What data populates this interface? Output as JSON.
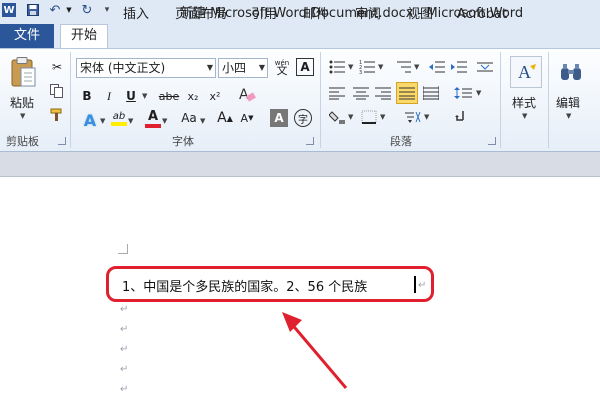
{
  "app": {
    "title": "新建 Microsoft Word Document.docx  -  Microsoft Word",
    "app_icon": "W"
  },
  "tabs": [
    "文件",
    "开始",
    "插入",
    "页面布局",
    "引用",
    "邮件",
    "审阅",
    "视图",
    "Acrobat"
  ],
  "active_tab": "开始",
  "ribbon": {
    "clipboard": {
      "group_label": "剪贴板",
      "paste_label": "粘贴"
    },
    "font": {
      "group_label": "字体",
      "font_name": "宋体 (中文正文)",
      "font_size": "小四",
      "bold": "B",
      "italic": "I",
      "underline": "U",
      "strike": "abe",
      "subscript": "x₂",
      "superscript": "x²",
      "text_effect": "A",
      "highlight": "ab",
      "font_color": "A",
      "case": "Aa",
      "grow": "A",
      "shrink": "A",
      "char_shading": "A",
      "enclose": "字",
      "phonetic": "wén",
      "border_char": "A",
      "clear_format": "A"
    },
    "paragraph": {
      "group_label": "段落"
    },
    "styles": {
      "label": "样式"
    },
    "editing": {
      "label": "编辑"
    }
  },
  "document": {
    "line1": "1、中国是个多民族的国家。2、56 个民族",
    "para_mark": "↵"
  },
  "colors": {
    "file_tab": "#2b579a",
    "annotation": "#e0202e",
    "font_color_bar": "#e0202e",
    "highlight_bar": "#ffee00"
  }
}
